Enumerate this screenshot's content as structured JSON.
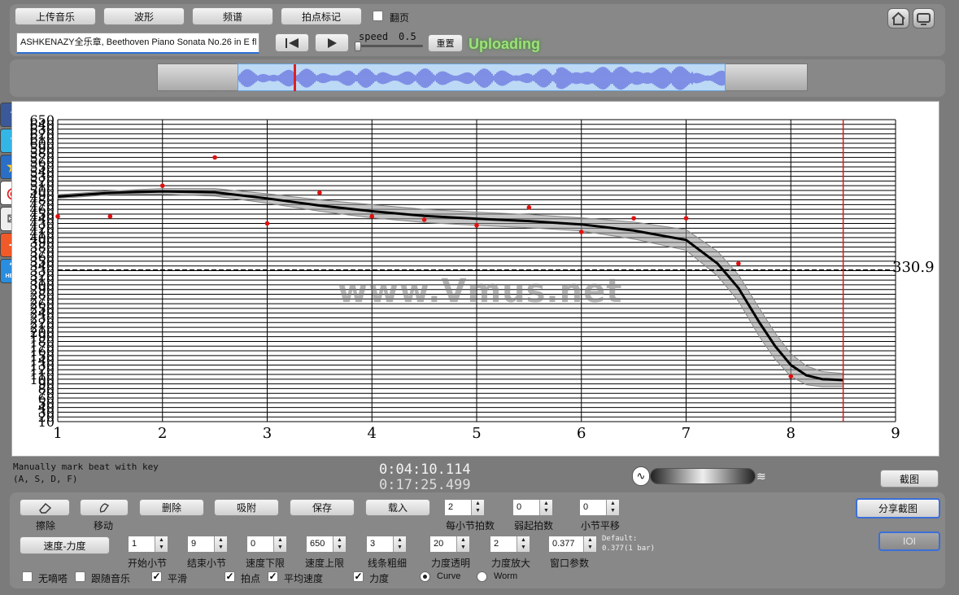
{
  "toolbar": {
    "upload_label": "上传音乐",
    "waveform_label": "波形",
    "spectrum_label": "频谱",
    "beat_mark_label": "拍点标记",
    "page_turn_label": "翻页",
    "track_title": "ASHKENAZY全乐章, Beethoven Piano Sonata No.26 in E fl",
    "speed_label": "speed",
    "speed_value": "0.5",
    "reset_label": "重置",
    "status_text": "Uploading"
  },
  "sidebar": {
    "icons": [
      "facebook-icon",
      "twitter-icon",
      "favorite-star-icon",
      "weibo-icon",
      "mail-icon",
      "add-plus-icon",
      "help-icon"
    ],
    "help_text": "HELP"
  },
  "chart": {
    "watermark": "www.Vmus.net",
    "reference_label": "330.9",
    "x_ticks": [
      "1",
      "2",
      "3",
      "4",
      "5",
      "6",
      "7",
      "8",
      "9"
    ],
    "y_ticks_major": [
      "650",
      "100",
      "10"
    ]
  },
  "chart_data": {
    "type": "line",
    "xlim": [
      1,
      9
    ],
    "ylim": [
      10,
      650
    ],
    "grid": true,
    "reference_line": 330.9,
    "cursor_x": 8.5,
    "curve_x": [
      1,
      1.5,
      2,
      2.5,
      3,
      3.5,
      4,
      4.5,
      5,
      5.5,
      6,
      6.5,
      7,
      7.3,
      7.5,
      7.7,
      7.85,
      8,
      8.15,
      8.3,
      8.5
    ],
    "curve_y": [
      487,
      495,
      498,
      496,
      483,
      468,
      456,
      446,
      440,
      435,
      428,
      415,
      395,
      345,
      293,
      220,
      170,
      130,
      108,
      100,
      98
    ],
    "band_half_width": [
      4,
      4,
      6,
      8,
      10,
      12,
      14,
      14,
      14,
      14,
      14,
      18,
      22,
      26,
      28,
      30,
      28,
      24,
      20,
      16,
      14
    ],
    "points_x": [
      1,
      1.5,
      2,
      2.5,
      3,
      3.5,
      4,
      4.5,
      5,
      5.5,
      6,
      6.5,
      7,
      7.5,
      8
    ],
    "points_y": [
      445,
      445,
      510,
      570,
      430,
      495,
      445,
      438,
      426,
      464,
      412,
      441,
      441,
      345,
      106
    ]
  },
  "status": {
    "hint_line1": "Manually mark beat with key",
    "hint_line2": "(A, S, D, F)",
    "current_time": "0:04:10.114",
    "total_time": "0:17:25.499",
    "screenshot_label": "截图"
  },
  "controls": {
    "erase_label": "擦除",
    "move_label": "移动",
    "delete_label": "删除",
    "attach_label": "吸附",
    "save_label": "保存",
    "load_label": "载入",
    "beats_per_bar_value": "2",
    "beats_per_bar_label": "每小节拍数",
    "pickup_value": "0",
    "pickup_label": "弱起拍数",
    "bar_shift_value": "0",
    "bar_shift_label": "小节平移",
    "share_label": "分享截图",
    "ioi_label": "IOI",
    "mode_label": "速度-力度",
    "start_bar_value": "1",
    "start_bar_label": "开始小节",
    "end_bar_value": "9",
    "end_bar_label": "结束小节",
    "tempo_min_value": "0",
    "tempo_min_label": "速度下限",
    "tempo_max_value": "650",
    "tempo_max_label": "速度上限",
    "line_width_value": "3",
    "line_width_label": "线条粗细",
    "dyn_opacity_value": "20",
    "dyn_opacity_label": "力度透明",
    "dyn_zoom_value": "2",
    "dyn_zoom_label": "力度放大",
    "window_value": "0.377",
    "window_label": "窗口参数",
    "default_line1": "Default:",
    "default_line2": "0.377(1 bar)",
    "no_beep_label": "无嘀嗒",
    "follow_music_label": "跟随音乐",
    "smooth_label": "平滑",
    "beat_point_label": "拍点",
    "avg_tempo_label": "平均速度",
    "dynamics_label": "力度",
    "curve_label": "Curve",
    "worm_label": "Worm"
  }
}
